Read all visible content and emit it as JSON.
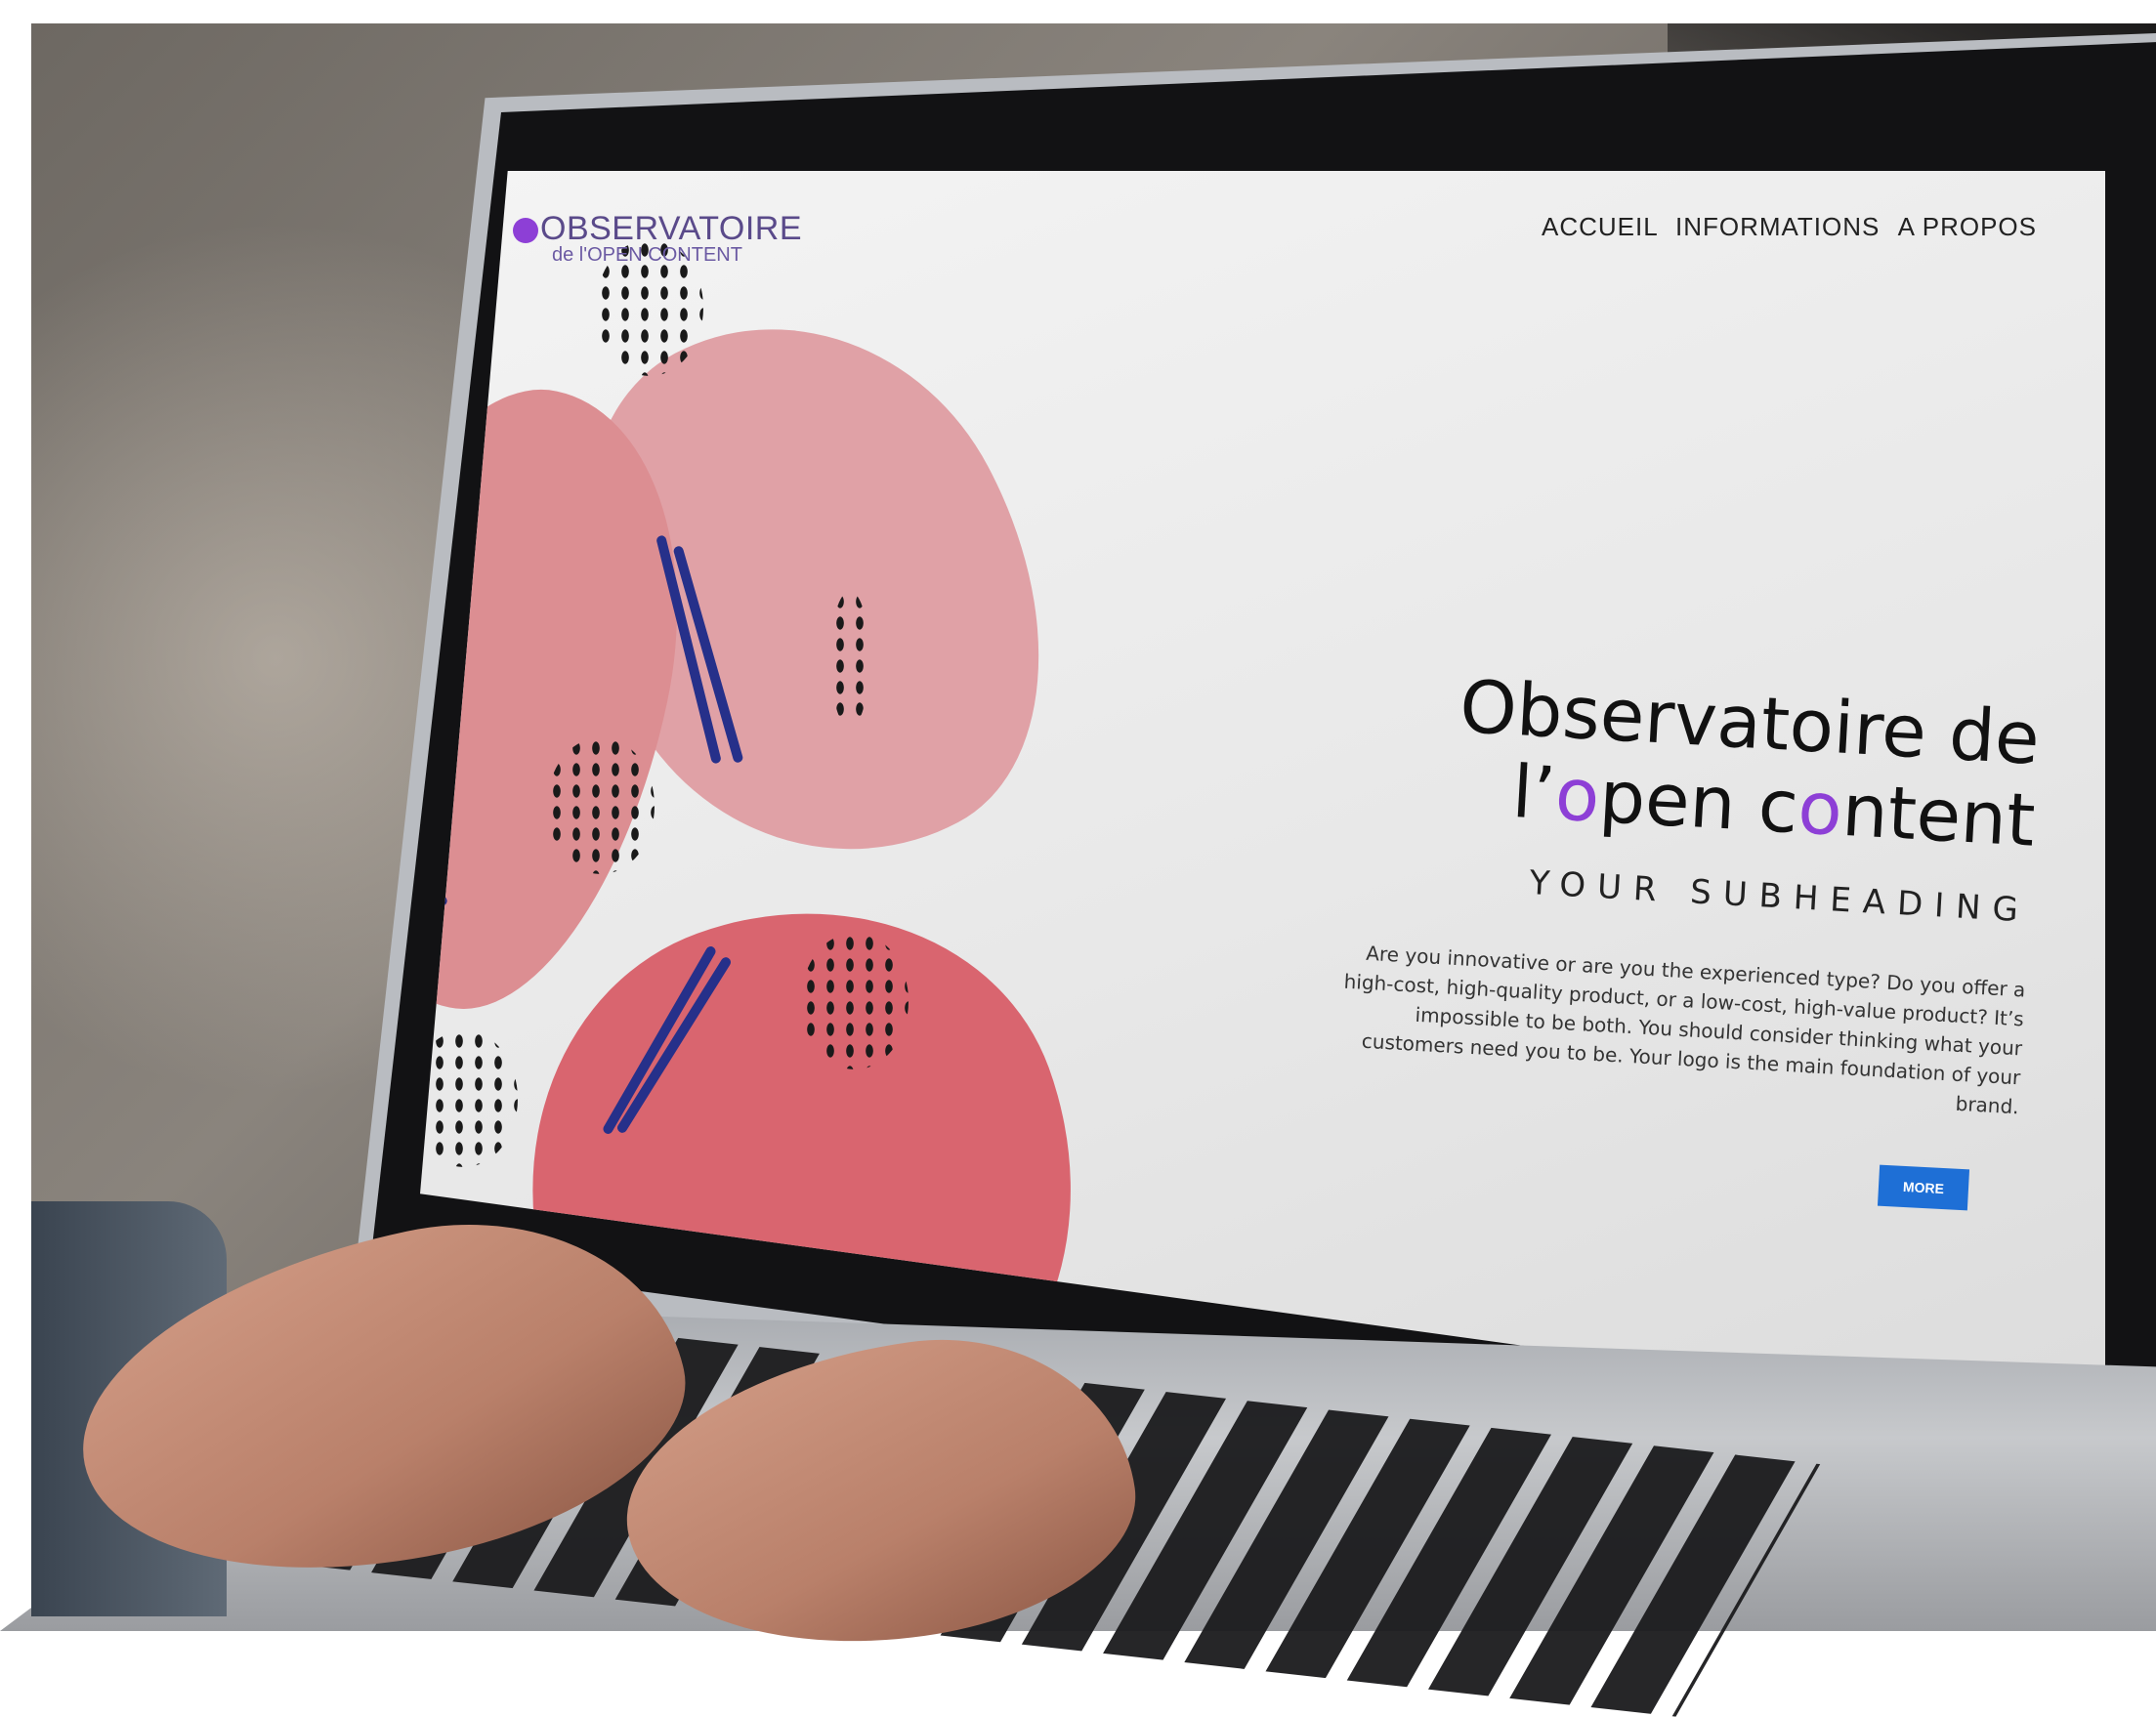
{
  "nav": {
    "items": [
      "ACCUEIL",
      "INFORMATIONS",
      "A PROPOS"
    ]
  },
  "logo": {
    "line1": "OBSERVATOIRE",
    "line2": "de l'OPEN CONTENT"
  },
  "hero": {
    "title_line1": "Observatoire de",
    "title_line2_a": "l’",
    "title_line2_b": "o",
    "title_line2_c": "pen c",
    "title_line2_d": "o",
    "title_line2_e": "ntent",
    "subheading": "YOUR SUBHEADING",
    "body": "Are you innovative or are you the experienced type? Do you offer a high-cost, high-quality product, or a low-cost, high-value product? It’s impossible to be both. You should consider thinking what your customers need you to be. Your logo is the main foundation of your brand.",
    "button_label": "MORE"
  },
  "colors": {
    "accent": "#8d3fd6",
    "button": "#1e6fd6",
    "blob_light": "#e0a1a6",
    "blob_dark": "#d9656f",
    "stroke": "#26308a"
  }
}
